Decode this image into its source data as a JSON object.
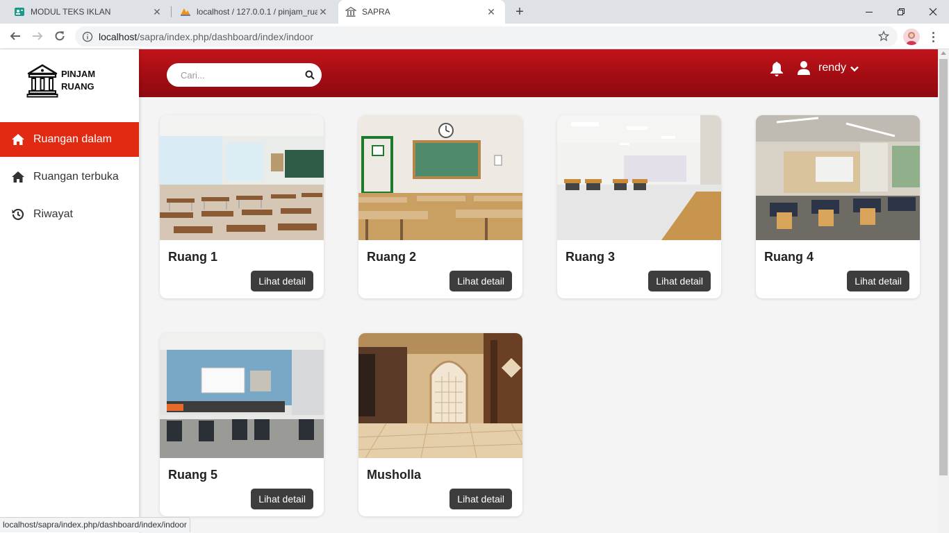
{
  "browser": {
    "tabs": [
      {
        "title": "MODUL TEKS IKLAN",
        "icon": "classroom-icon"
      },
      {
        "title": "localhost / 127.0.0.1 / pinjam_rua",
        "icon": "phpmyadmin-icon"
      },
      {
        "title": "SAPRA",
        "icon": "bank-icon"
      }
    ],
    "url_host": "localhost",
    "url_path": "/sapra/index.php/dashboard/index/indoor",
    "status_url": "localhost/sapra/index.php/dashboard/index/indoor"
  },
  "app": {
    "logo_line1": "PINJAM",
    "logo_line2": "RUANG",
    "accent_color": "#e12a11",
    "header_color": "#b10f16"
  },
  "sidebar": {
    "items": [
      {
        "label": "Ruangan dalam",
        "icon": "home-icon",
        "active": true
      },
      {
        "label": "Ruangan terbuka",
        "icon": "home-icon",
        "active": false
      },
      {
        "label": "Riwayat",
        "icon": "history-icon",
        "active": false
      }
    ]
  },
  "header": {
    "search_placeholder": "Cari...",
    "username": "rendy"
  },
  "rooms": [
    {
      "name": "Ruang 1",
      "button": "Lihat detail"
    },
    {
      "name": "Ruang 2",
      "button": "Lihat detail"
    },
    {
      "name": "Ruang 3",
      "button": "Lihat detail"
    },
    {
      "name": "Ruang 4",
      "button": "Lihat detail"
    },
    {
      "name": "Ruang 5",
      "button": "Lihat detail"
    },
    {
      "name": "Musholla",
      "button": "Lihat detail"
    }
  ]
}
